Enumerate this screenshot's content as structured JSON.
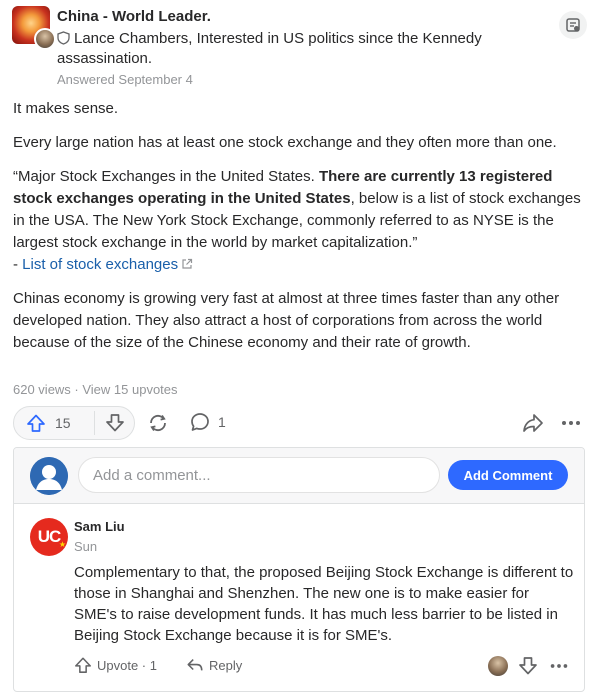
{
  "header": {
    "space_name": "China - World Leader.",
    "credential": "Lance Chambers, Interested in US politics since the Kennedy assassination.",
    "answered_date": "Answered September 4"
  },
  "answer": {
    "p1": "It makes sense.",
    "p2": "Every large nation has at least one stock exchange and they often more than one.",
    "p3_quote_start": "“Major Stock Exchanges in the United States. ",
    "p3_quote_bold": "There are currently 13 registered stock exchanges operating in the United States",
    "p3_quote_end": ", below is a list of stock exchanges in the USA. The New York Stock Exchange, commonly referred to as NYSE is the largest stock exchange in the world by market capitalization.”",
    "p3_source_prefix": "- ",
    "p3_link": "List of stock exchanges",
    "p4": "Chinas economy is growing very fast at almost at three times faster than any other developed nation. They also attract a host of corporations from across the world because of the size of the Chinese economy and their rate of growth."
  },
  "stats": "620 views · View 15 upvotes",
  "actions": {
    "upvote_count": "15",
    "comment_count": "1"
  },
  "comment_box": {
    "placeholder": "Add a comment...",
    "button_label": "Add Comment"
  },
  "comment": {
    "avatar_text": "UC",
    "author": "Sam Liu",
    "time": "Sun",
    "text": "Complementary to that, the proposed Beijing Stock Exchange is different to those in Shanghai and Shenzhen. The new one is to make easier for SME's to raise development funds. It has much less barrier to be listed in Beijing Stock Exchange because it is for SME's.",
    "upvote_label": "Upvote · 1",
    "reply_label": "Reply"
  },
  "colors": {
    "primary_button": "#2e69ff",
    "link": "#195faa",
    "muted_text": "#939598"
  },
  "icons": [
    "shield-icon",
    "space-icon",
    "external-link-icon",
    "upvote-arrow-icon",
    "downvote-arrow-icon",
    "reshare-icon",
    "comment-bubble-icon",
    "share-arrow-icon",
    "more-icon",
    "reply-arrow-icon"
  ]
}
